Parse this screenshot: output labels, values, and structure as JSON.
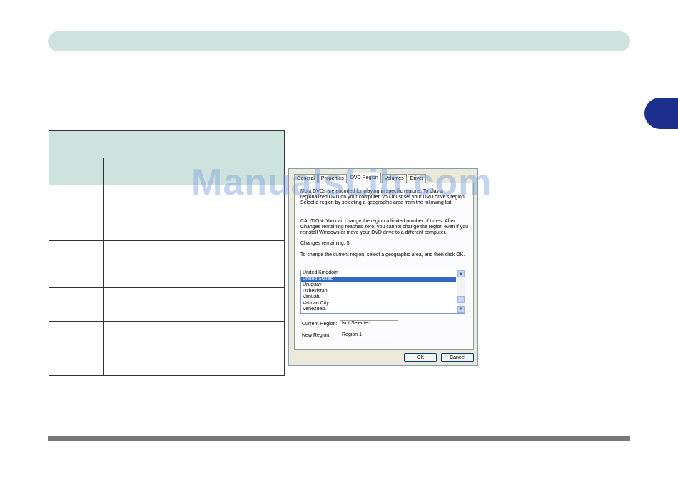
{
  "dialog": {
    "tabs": [
      "General",
      "Properties",
      "DVD Region",
      "Volumes",
      "Driver"
    ],
    "active_tab": "DVD Region",
    "intro_text": "Most DVDs are encoded for playing in specific regions. To play a regionalized DVD on your computer, you must set your DVD drive's region. Select a region by selecting a geographic area from the following list.",
    "caution_text": "CAUTION: You can change the region a limited number of times. After Changes remaining reaches zero, you cannot change the region even if you reinstall Windows or move your DVD drive to a different computer.",
    "changes_remaining": "Changes remaining: 5",
    "instruction_text": "To change the current region, select a geographic area, and then click OK.",
    "list_items": [
      "United Kingdom",
      "United States",
      "Uruguay",
      "Uzbekistan",
      "Vanuatu",
      "Vatican City",
      "Venezuela"
    ],
    "selected_item": "United States",
    "current_region_label": "Current Region:",
    "current_region_value": "Not Selected",
    "new_region_label": "New Region:",
    "new_region_value": "Region 1",
    "ok_label": "OK",
    "cancel_label": "Cancel"
  },
  "watermark": "ManualsLib.com",
  "colors": {
    "header_bar": "#cfe3de",
    "chapter_tab": "#1c2f8c",
    "list_selection": "#316ac5"
  }
}
